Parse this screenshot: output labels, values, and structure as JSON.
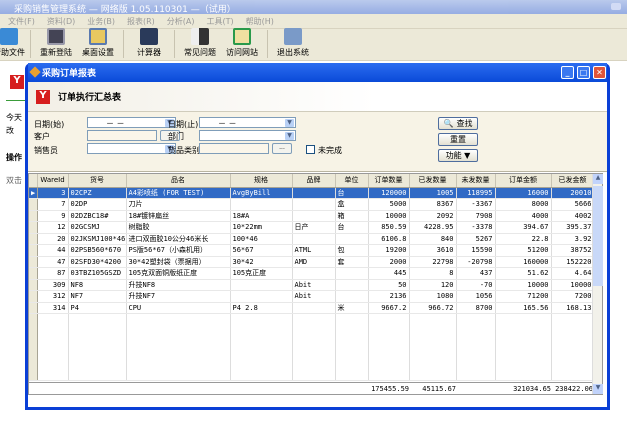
{
  "app": {
    "title": "采购销售管理系统 — 网络版 1.05.110301 —（试用）",
    "menu": [
      "文件(F)",
      "资料(D)",
      "业务(B)",
      "报表(R)",
      "分析(A)",
      "工具(T)",
      "帮助(H)"
    ],
    "toolbar": [
      "帮助文件",
      "重新登陆",
      "桌面设置",
      "计算器",
      "常见问题",
      "访问网站",
      "退出系统"
    ]
  },
  "left": {
    "items": [
      "今天",
      "改",
      "操作",
      "双击"
    ]
  },
  "window": {
    "title": "采购订单报表",
    "banner": "订单执行汇总表"
  },
  "filter": {
    "date_start_label": "日期(始)",
    "date_start_value": "－ －",
    "date_end_label": "日期(止)",
    "date_end_value": "－ －",
    "customer_label": "客户",
    "dept_label": "部门",
    "sales_label": "销售员",
    "category_label": "货品类别",
    "ellipsis": "...",
    "incomplete_label": "未完成",
    "search": "查找",
    "reset": "重置",
    "function": "功能 ▼"
  },
  "grid": {
    "headers": [
      "WareId",
      "货号",
      "品名",
      "规格",
      "品牌",
      "单位",
      "订单数量",
      "已发数量",
      "未发数量",
      "订单金额",
      "已发金额"
    ],
    "rows": [
      [
        "3",
        "02CPZ",
        "A4彩喷纸 (FOR TEST)",
        "AvgByBill",
        "",
        "台",
        "120000",
        "1005",
        "118995",
        "16000",
        "20010"
      ],
      [
        "7",
        "02DP",
        "刀片",
        "",
        "",
        "盒",
        "5000",
        "8367",
        "-3367",
        "8000",
        "5666"
      ],
      [
        "9",
        "02DZBC18#",
        "18#镀锌扁丝",
        "18#A",
        "",
        "箱",
        "10000",
        "2092",
        "7908",
        "4000",
        "4002"
      ],
      [
        "12",
        "02GCSMJ",
        "树脂胶",
        "10*22mm",
        "日产",
        "台",
        "850.59",
        "4228.95",
        "-3378",
        "394.67",
        "395.37"
      ],
      [
        "20",
        "02JKSMJ100*46",
        "进口双面胶10公分46米长",
        "100*46",
        "",
        "",
        "6106.8",
        "840",
        "5267",
        "22.8",
        "3.92"
      ],
      [
        "44",
        "02PSB560*670",
        "PS版56*67（小森机用）",
        "56*67",
        "ATML",
        "包",
        "19200",
        "3610",
        "15590",
        "51200",
        "38752"
      ],
      [
        "47",
        "02SFD30*4200",
        "30*42塑封袋（票据用）",
        "30*42",
        "AMD",
        "套",
        "2000",
        "22798",
        "-20798",
        "160000",
        "152220"
      ],
      [
        "87",
        "03TBZ105GSZD",
        "105克双面铜版纸正度",
        "105克正度",
        "",
        "",
        "445",
        "8",
        "437",
        "51.62",
        "4.64"
      ],
      [
        "309",
        "NF8",
        "升技NF8",
        "",
        "Abit",
        "",
        "50",
        "120",
        "-70",
        "10000",
        "10000"
      ],
      [
        "312",
        "NF7",
        "升技NF7",
        "",
        "Abit",
        "",
        "2136",
        "1080",
        "1056",
        "71200",
        "7200"
      ],
      [
        "314",
        "P4",
        "CPU",
        "P4 2.8",
        "",
        "米",
        "9667.2",
        "966.72",
        "8700",
        "165.56",
        "168.13"
      ]
    ],
    "totals": {
      "order_qty": "175455.59",
      "shipped_qty": "45115.67",
      "order_amt": "321034.65",
      "shipped_amt": "238422.06"
    }
  },
  "colors": {
    "selection": "#316ac5",
    "titlebar": "#0a4ad8"
  }
}
